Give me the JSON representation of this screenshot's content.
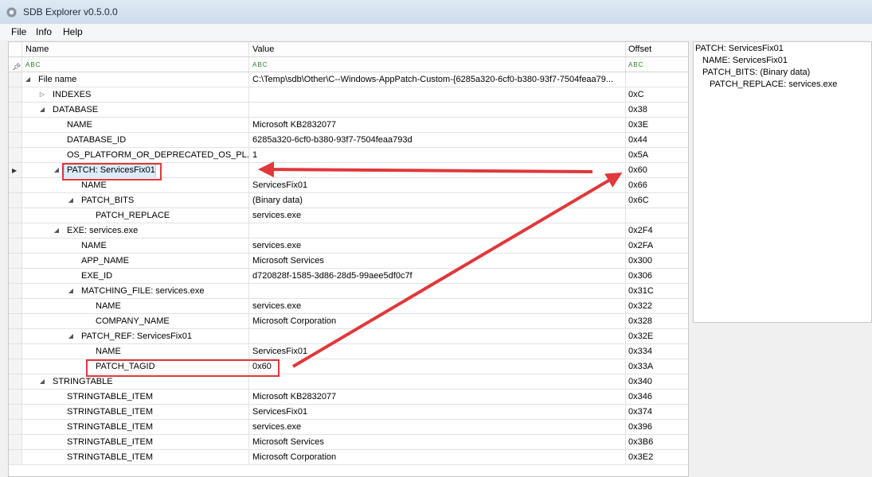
{
  "window": {
    "title": "SDB Explorer v0.5.0.0"
  },
  "menu": [
    "File",
    "Info",
    "Help"
  ],
  "grid": {
    "columns": {
      "name": "Name",
      "value": "Value",
      "offset": "Offset"
    },
    "filter_icon": "ABC",
    "rows": [
      {
        "label": "File name",
        "value": "C:\\Temp\\sdb\\Other\\C--Windows-AppPatch-Custom-{6285a320-6cf0-b380-93f7-7504feaa79...",
        "offset": ""
      },
      {
        "label": "INDEXES",
        "value": "",
        "offset": "0xC"
      },
      {
        "label": "DATABASE",
        "value": "",
        "offset": "0x38"
      },
      {
        "label": "NAME",
        "value": "Microsoft KB2832077",
        "offset": "0x3E"
      },
      {
        "label": "DATABASE_ID",
        "value": "6285a320-6cf0-b380-93f7-7504feaa793d",
        "offset": "0x44"
      },
      {
        "label": "OS_PLATFORM_OR_DEPRECATED_OS_PL...",
        "value": "1",
        "offset": "0x5A"
      },
      {
        "label": "PATCH: ServicesFix01",
        "value": "",
        "offset": "0x60"
      },
      {
        "label": "NAME",
        "value": "ServicesFix01",
        "offset": "0x66"
      },
      {
        "label": "PATCH_BITS",
        "value": "(Binary data)",
        "offset": "0x6C"
      },
      {
        "label": "PATCH_REPLACE",
        "value": "services.exe",
        "offset": ""
      },
      {
        "label": "EXE: services.exe",
        "value": "",
        "offset": "0x2F4"
      },
      {
        "label": "NAME",
        "value": "services.exe",
        "offset": "0x2FA"
      },
      {
        "label": "APP_NAME",
        "value": "Microsoft Services",
        "offset": "0x300"
      },
      {
        "label": "EXE_ID",
        "value": "d720828f-1585-3d86-28d5-99aee5df0c7f",
        "offset": "0x306"
      },
      {
        "label": "MATCHING_FILE: services.exe",
        "value": "",
        "offset": "0x31C"
      },
      {
        "label": "NAME",
        "value": "services.exe",
        "offset": "0x322"
      },
      {
        "label": "COMPANY_NAME",
        "value": "Microsoft Corporation",
        "offset": "0x328"
      },
      {
        "label": "PATCH_REF: ServicesFix01",
        "value": "",
        "offset": "0x32E"
      },
      {
        "label": "NAME",
        "value": "ServicesFix01",
        "offset": "0x334"
      },
      {
        "label": "PATCH_TAGID",
        "value": "0x60",
        "offset": "0x33A"
      },
      {
        "label": "STRINGTABLE",
        "value": "",
        "offset": "0x340"
      },
      {
        "label": "STRINGTABLE_ITEM",
        "value": "Microsoft KB2832077",
        "offset": "0x346"
      },
      {
        "label": "STRINGTABLE_ITEM",
        "value": "ServicesFix01",
        "offset": "0x374"
      },
      {
        "label": "STRINGTABLE_ITEM",
        "value": "services.exe",
        "offset": "0x396"
      },
      {
        "label": "STRINGTABLE_ITEM",
        "value": "Microsoft Services",
        "offset": "0x3B6"
      },
      {
        "label": "STRINGTABLE_ITEM",
        "value": "Microsoft Corporation",
        "offset": "0x3E2"
      }
    ]
  },
  "details": {
    "lines": [
      "PATCH: ServicesFix01",
      "NAME: ServicesFix01",
      "PATCH_BITS: (Binary data)",
      "PATCH_REPLACE: services.exe"
    ]
  },
  "colors": {
    "annotation": "#e0383c",
    "selection": "#dcecfb"
  },
  "icons": {
    "app": "sdb-explorer-app-icon",
    "filter": "filter-text-icon",
    "pin": "pin-icon"
  }
}
